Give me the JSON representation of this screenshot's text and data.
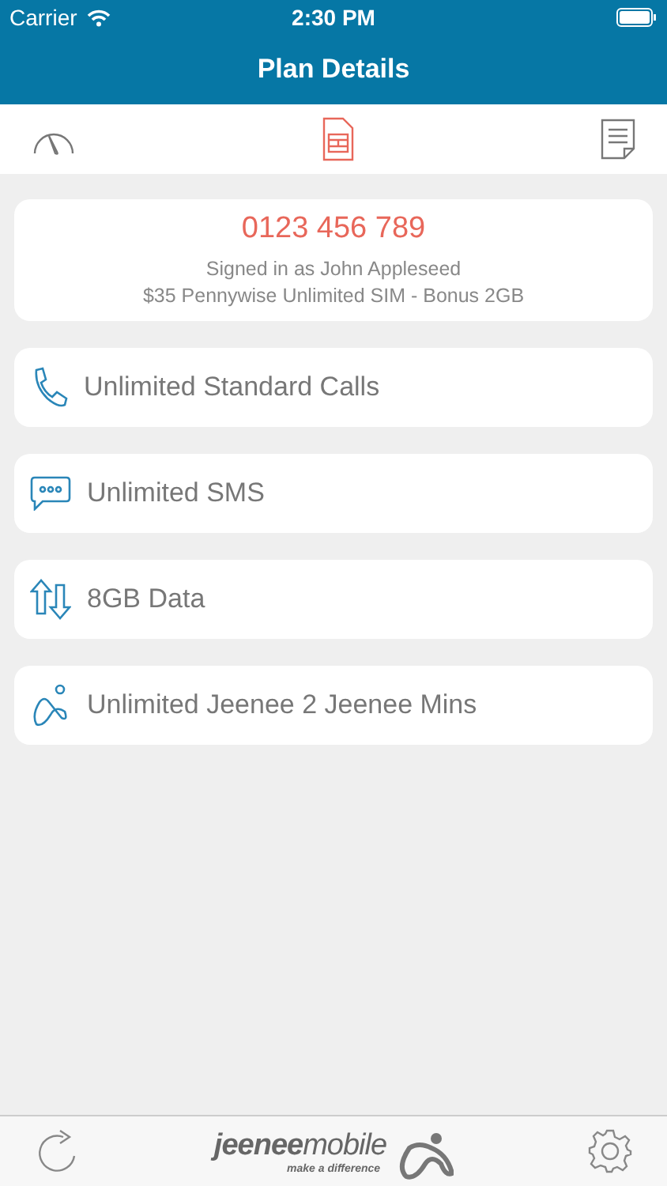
{
  "status_bar": {
    "carrier": "Carrier",
    "time": "2:30 PM"
  },
  "nav_bar": {
    "title": "Plan Details"
  },
  "tabs": [
    {
      "kind": "gauge",
      "selected": false
    },
    {
      "kind": "sim",
      "selected": true
    },
    {
      "kind": "document",
      "selected": false
    }
  ],
  "account": {
    "number": "0123 456 789",
    "signed_in": "Signed in as John Appleseed",
    "plan": "$35 Pennywise Unlimited SIM - Bonus 2GB"
  },
  "features": [
    {
      "kind": "calls",
      "label": "Unlimited Standard Calls"
    },
    {
      "kind": "sms",
      "label": "Unlimited SMS"
    },
    {
      "kind": "data",
      "label": "8GB Data"
    },
    {
      "kind": "jeenee",
      "label": "Unlimited Jeenee 2 Jeenee Mins"
    }
  ],
  "footer": {
    "logo_word_1": "jeenee",
    "logo_word_2": "mobile",
    "tagline": "make a difference"
  }
}
